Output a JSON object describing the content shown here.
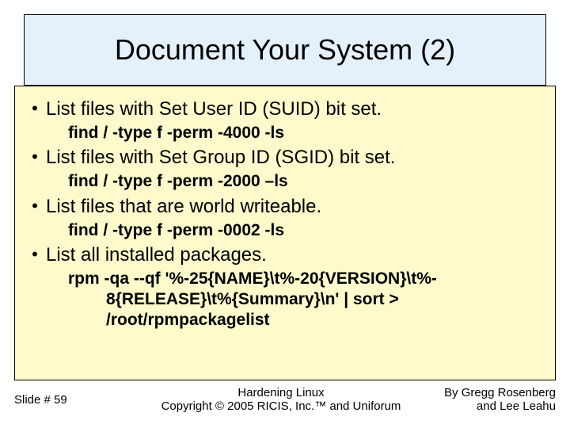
{
  "title": "Document Your System (2)",
  "bullets": {
    "b1_text": "List files with Set User ID (SUID) bit set.",
    "b1_cmd": "find / -type f -perm -4000 -ls",
    "b2_text": "List files with Set Group ID (SGID) bit set.",
    "b2_cmd": "find / -type f -perm -2000 –ls",
    "b3_text": "List files that are world writeable.",
    "b3_cmd": "find / -type f -perm -0002 -ls",
    "b4_text": "List all installed packages.",
    "b4_cmd_l1": "rpm -qa --qf '%-25{NAME}\\t%-20{VERSION}\\t%-",
    "b4_cmd_l2": "8{RELEASE}\\t%{Summary}\\n' | sort >",
    "b4_cmd_l3": "/root/rpmpackagelist"
  },
  "footer": {
    "slide_num": "Slide # 59",
    "center_l1": "Hardening Linux",
    "center_l2": "Copyright © 2005 RICIS, Inc.™ and Uniforum",
    "right_l1": "By Gregg Rosenberg",
    "right_l2": "and Lee Leahu"
  }
}
